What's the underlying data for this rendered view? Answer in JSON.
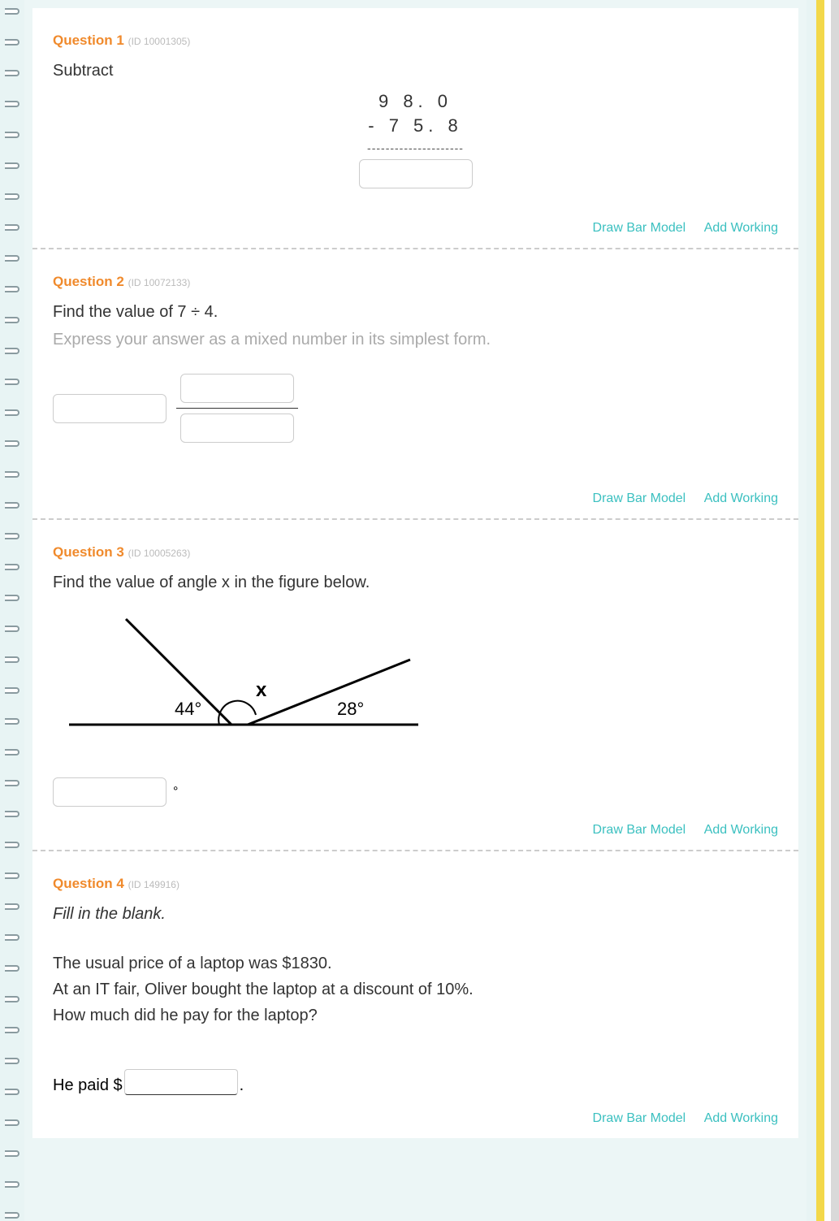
{
  "questions": [
    {
      "number_label": "Question 1",
      "id_label": "(ID 10001305)",
      "prompt": "Subtract",
      "subtract": {
        "top": "9 8. 0",
        "bottom": "- 7 5. 8",
        "dashes": "---------------------"
      },
      "actions": {
        "bar": "Draw Bar Model",
        "work": "Add Working"
      }
    },
    {
      "number_label": "Question 2",
      "id_label": "(ID 10072133)",
      "prompt": "Find the value of 7 ÷ 4.",
      "hint": "Express your answer as a mixed number in its simplest form.",
      "actions": {
        "bar": "Draw Bar Model",
        "work": "Add Working"
      }
    },
    {
      "number_label": "Question 3",
      "id_label": "(ID 10005263)",
      "prompt": "Find the value of angle x in the figure below.",
      "angle": {
        "left": "44°",
        "right": "28°",
        "x": "x",
        "degree": "°"
      },
      "actions": {
        "bar": "Draw Bar Model",
        "work": "Add Working"
      }
    },
    {
      "number_label": "Question 4",
      "id_label": "(ID 149916)",
      "prompt": "Fill in the blank.",
      "body": {
        "l1": "The usual price of a laptop was $1830.",
        "l2": "At an IT fair, Oliver bought the laptop at a discount of 10%.",
        "l3": "How much did he pay for the laptop?"
      },
      "answer": {
        "prefix": "He paid $",
        "suffix": "."
      },
      "actions": {
        "bar": "Draw Bar Model",
        "work": "Add Working"
      }
    }
  ]
}
